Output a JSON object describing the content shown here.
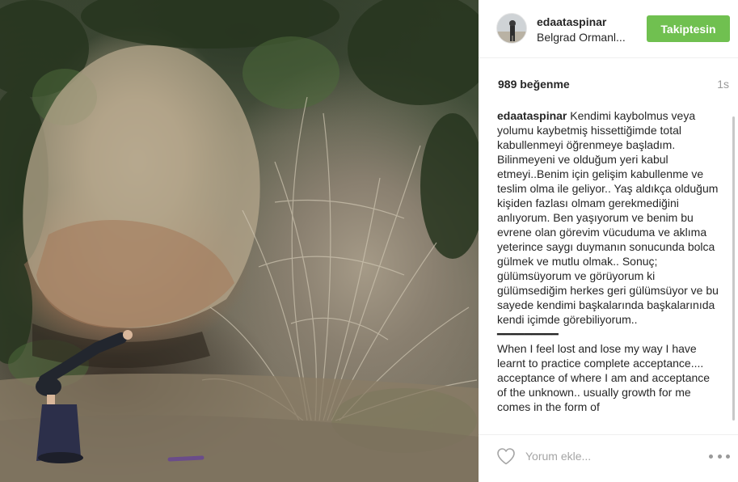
{
  "post": {
    "username": "edaataspinar",
    "location": "Belgrad Ormanl...",
    "follow_label": "Takiptesin",
    "likes": "989 beğenme",
    "time_ago": "1s",
    "caption_user": "edaataspinar",
    "caption_text": " Kendimi kaybolmus veya yolumu kaybetmiş hissettiğimde total kabullenmeyi öğrenmeye başladım. Bilinmeyeni ve olduğum yeri kabul etmeyi..Benim için gelişim kabullenme ve teslim olma ile geliyor.. Yaş aldıkça olduğum kişiden fazlası olmam gerekmediğini anlıyorum. Ben yaşıyorum ve benim bu evrene olan görevim vücuduma ve aklıma yeterince saygı duymanın sonucunda bolca gülmek ve mutlu olmak.. Sonuç; gülümsüyorum ve görüyorum ki gülümsediğim herkes geri gülümsüyor ve bu sayede kendimi başkalarında başkalarınıda kendi içimde görebiliyorum..\n━━━━━━━━━\nWhen I feel lost and lose my way I have learnt to practice complete acceptance.... acceptance of where I am and acceptance of the unknown.. usually growth for me comes in the form of",
    "comment_placeholder": "Yorum ekle..."
  },
  "icons": {
    "like": "heart-outline-icon",
    "more": "ellipsis-icon"
  },
  "colors": {
    "follow_button": "#70c050",
    "text": "#262626",
    "muted": "#999999"
  }
}
